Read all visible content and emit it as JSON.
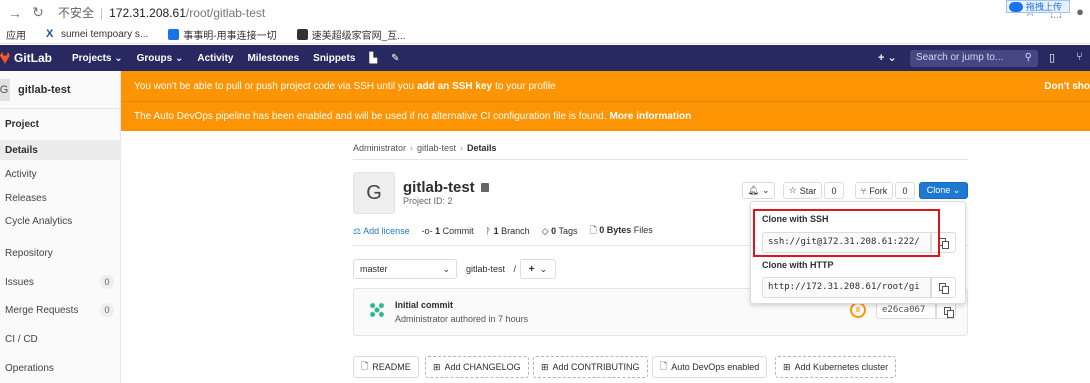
{
  "browser": {
    "insecure_label": "不安全",
    "url_host": "172.31.208.61",
    "url_path": "/root/gitlab-test",
    "upload_badge": "拖拽上传",
    "bookmarks": [
      "应用",
      "sumei tempoary s...",
      "事事明-用事连接一切",
      "速美超级家官网_互..."
    ]
  },
  "topnav": {
    "logo_text": "GitLab",
    "menu": [
      "Projects ⌄",
      "Groups ⌄",
      "Activity",
      "Milestones",
      "Snippets"
    ],
    "new_label": "+ ⌄",
    "search_placeholder": "Search or jump to..."
  },
  "sidebar": {
    "avatar_letter": "G",
    "project_name": "gitlab-test",
    "items": [
      {
        "label": "Project"
      },
      {
        "label": "Details"
      },
      {
        "label": "Activity"
      },
      {
        "label": "Releases"
      },
      {
        "label": "Cycle Analytics"
      },
      {
        "label": "Repository"
      },
      {
        "label": "Issues",
        "count": "0"
      },
      {
        "label": "Merge Requests",
        "count": "0"
      },
      {
        "label": "CI / CD"
      },
      {
        "label": "Operations"
      }
    ]
  },
  "banners": {
    "ssh_pre": "You won't be able to pull or push project code via SSH until you ",
    "ssh_link": "add an SSH key",
    "ssh_post": " to your profile",
    "ssh_dismiss": "Don't sho",
    "devops_text": "The Auto DevOps pipeline has been enabled and will be used if no alternative CI configuration file is found. ",
    "devops_link": "More information"
  },
  "breadcrumb": [
    "Administrator",
    "gitlab-test",
    "Details"
  ],
  "project": {
    "avatar_letter": "G",
    "name": "gitlab-test",
    "id_label": "Project ID: 2"
  },
  "actions": {
    "notify_label": "⌄",
    "star_label": "Star",
    "star_count": "0",
    "fork_label": "Fork",
    "fork_count": "0",
    "clone_label": "Clone ⌄"
  },
  "stats": {
    "add_license": "Add license",
    "commits_num": "1",
    "commits_label": "Commit",
    "branches_num": "1",
    "branches_label": "Branch",
    "tags_num": "0",
    "tags_label": "Tags",
    "files_num": "0 Bytes",
    "files_label": "Files"
  },
  "repo": {
    "branch": "master",
    "path_segment": "gitlab-test",
    "path_sep": "/",
    "add_label": "+"
  },
  "commit": {
    "title": "Initial commit",
    "author_line": "Administrator authored in 7 hours",
    "sha": "e26ca067"
  },
  "quick_buttons": [
    "README",
    "Add CHANGELOG",
    "Add CONTRIBUTING",
    "Auto DevOps enabled",
    "Add Kubernetes cluster"
  ],
  "clone": {
    "ssh_label": "Clone with SSH",
    "ssh_url": "ssh://git@172.31.208.61:222/",
    "http_label": "Clone with HTTP",
    "http_url": "http://172.31.208.61/root/gi"
  },
  "colors": {
    "nav_bg": "#292961",
    "banner": "#fc9403",
    "primary": "#1f78d1",
    "highlight": "#e0131a"
  }
}
